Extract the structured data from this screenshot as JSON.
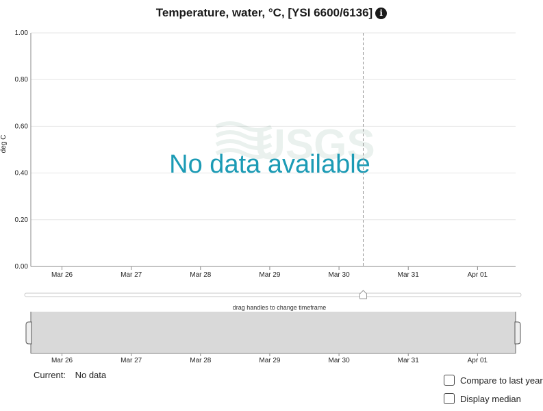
{
  "title": "Temperature, water, °C, [YSI 6600/6136]",
  "info_icon": "info-circle-icon",
  "no_data_message": "No data available",
  "brush_hint": "drag handles to change timeframe",
  "current": {
    "label": "Current:",
    "value": "No data"
  },
  "options": {
    "compare_last_year": "Compare to last year",
    "display_median": "Display median"
  },
  "colors": {
    "no_data_text": "#1c9bb5",
    "brush_fill": "#d9d9d9",
    "grid": "#e6e6e6"
  },
  "chart_data": {
    "type": "line",
    "ylabel": "deg C",
    "ylim": [
      0,
      1
    ],
    "yticks": [
      "1.00",
      "0.80",
      "0.60",
      "0.40",
      "0.20",
      "0.00"
    ],
    "ytick_values": [
      1.0,
      0.8,
      0.6,
      0.4,
      0.2,
      0.0
    ],
    "xticks": [
      "Mar 26",
      "Mar 27",
      "Mar 28",
      "Mar 29",
      "Mar 30",
      "Mar 31",
      "Apr 01"
    ],
    "xlim_days": [
      0,
      7
    ],
    "xtick_days": [
      0.45,
      1.45,
      2.45,
      3.45,
      4.45,
      5.45,
      6.45
    ],
    "current_time_day": 4.8,
    "series": [],
    "grid": true,
    "watermark": "USGS"
  }
}
